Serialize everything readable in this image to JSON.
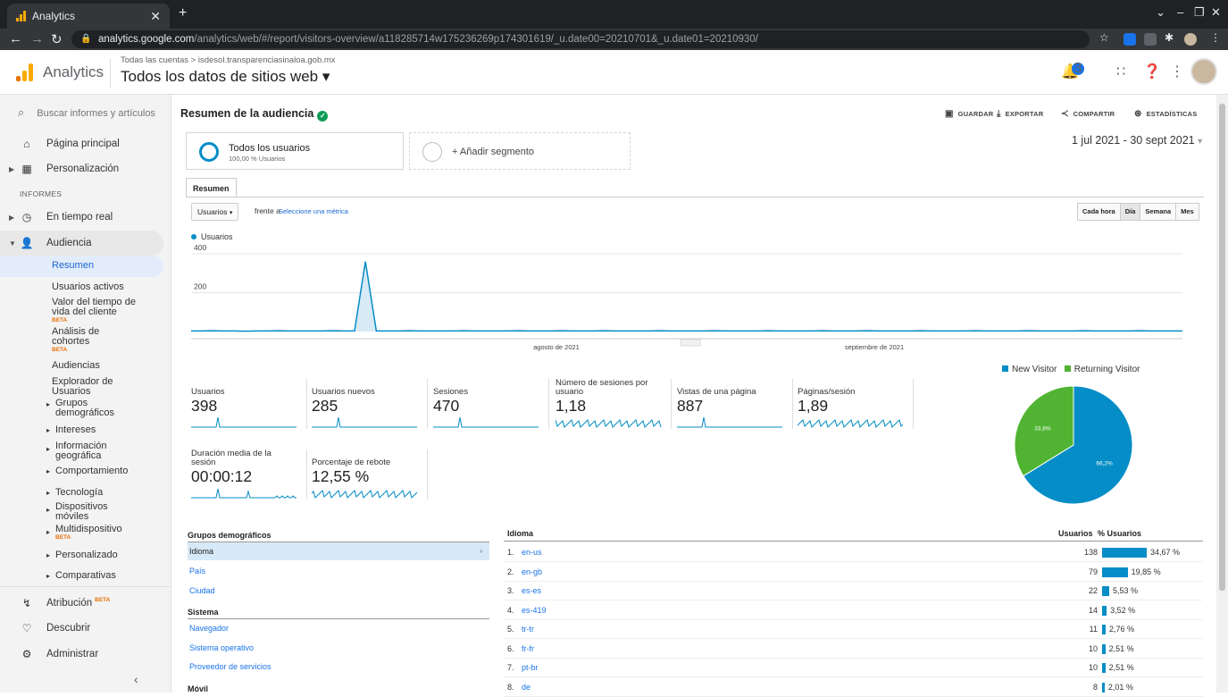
{
  "browser": {
    "tab_title": "Analytics",
    "url_host": "analytics.google.com",
    "url_path": "/analytics/web/#/report/visitors-overview/a118285714w175236269p174301619/_u.date00=20210701&_u.date01=20210930/"
  },
  "header": {
    "app_name": "Analytics",
    "breadcrumb": "Todas las cuentas > isdesol.transparenciasinaloa.gob.mx",
    "property": "Todos los datos de sitios web ▾",
    "notif_count": "3"
  },
  "sidebar": {
    "search_placeholder": "Buscar informes y artículos",
    "home": "Página principal",
    "custom": "Personalización",
    "section_reports": "INFORMES",
    "realtime": "En tiempo real",
    "audience": "Audiencia",
    "audience_items": [
      "Resumen",
      "Usuarios activos",
      "Valor del tiempo de vida del cliente",
      "Análisis de cohortes",
      "Audiencias",
      "Explorador de Usuarios",
      "Grupos demográficos",
      "Intereses",
      "Información geográfica",
      "Comportamiento",
      "Tecnología",
      "Dispositivos móviles",
      "Multidispositivo",
      "Personalizado",
      "Comparativas"
    ],
    "beta": "BETA",
    "attribution": "Atribución",
    "discover": "Descubrir",
    "admin": "Administrar"
  },
  "report": {
    "title": "Resumen de la audiencia",
    "actions": [
      "GUARDAR",
      "EXPORTAR",
      "COMPARTIR",
      "ESTADÍSTICAS"
    ],
    "segment1_title": "Todos los usuarios",
    "segment1_sub": "100,00 % Usuarios",
    "segment2_title": "+ Añadir segmento",
    "date_range": "1 jul 2021 - 30 sept 2021",
    "subtab": "Resumen",
    "metric_select": "Usuarios",
    "vs": "frente a",
    "select_metric": "Seleccione una métrica",
    "granularity": [
      "Cada hora",
      "Día",
      "Semana",
      "Mes"
    ],
    "granularity_active": "Día"
  },
  "chart_data": [
    {
      "type": "area",
      "series": [
        {
          "name": "Usuarios",
          "values": [
            3,
            3,
            4,
            3,
            3,
            2,
            3,
            3,
            4,
            3,
            3,
            3,
            3,
            4,
            3,
            3,
            360,
            3,
            3,
            3,
            4,
            3,
            3,
            3,
            3,
            4,
            3,
            3,
            3,
            3,
            4,
            3,
            3,
            3,
            4,
            3,
            3,
            3,
            4,
            3,
            3,
            3,
            3,
            4,
            3,
            3,
            3,
            3,
            4,
            3,
            3,
            3,
            3,
            4,
            3,
            3,
            3,
            3,
            4,
            3,
            3,
            3,
            4,
            3,
            3,
            3,
            3,
            4,
            3,
            3,
            3,
            3,
            4,
            3,
            3,
            3,
            3,
            4,
            3,
            3,
            3,
            3,
            4,
            3,
            3,
            3,
            3,
            4,
            3,
            3,
            3,
            3
          ]
        }
      ],
      "x_start": "1 jul 2021",
      "y_ticks": [
        "400",
        "200"
      ],
      "ylim": [
        0,
        400
      ],
      "x_labels": [
        "agosto de 2021",
        "septiembre de 2021"
      ]
    },
    {
      "type": "pie",
      "legend": [
        "New Visitor",
        "Returning Visitor"
      ],
      "values": [
        66.2,
        33.8
      ],
      "labels": [
        "66,2%",
        "33,8%"
      ],
      "colors": [
        "#058dc7",
        "#50b432"
      ]
    }
  ],
  "scorecards": [
    {
      "label": "Usuarios",
      "value": "398"
    },
    {
      "label": "Usuarios nuevos",
      "value": "285"
    },
    {
      "label": "Sesiones",
      "value": "470"
    },
    {
      "label": "Número de sesiones por usuario",
      "value": "1,18"
    },
    {
      "label": "Vistas de una página",
      "value": "887"
    },
    {
      "label": "Páginas/sesión",
      "value": "1,89"
    },
    {
      "label": "Duración media de la sesión",
      "value": "00:00:12"
    },
    {
      "label": "Porcentaje de rebote",
      "value": "12,55 %"
    }
  ],
  "dimensions": {
    "groups_title": "Grupos demográficos",
    "groups": [
      "Idioma",
      "País",
      "Ciudad"
    ],
    "system_title": "Sistema",
    "system": [
      "Navegador",
      "Sistema operativo",
      "Proveedor de servicios"
    ],
    "mobile_title": "Móvil"
  },
  "table": {
    "col_dim": "Idioma",
    "col_users": "Usuarios",
    "col_pct": "% Usuarios",
    "rows": [
      {
        "rank": "1.",
        "lang": "en-us",
        "users": "138",
        "pct": "34,67 %",
        "frac": 0.3467
      },
      {
        "rank": "2.",
        "lang": "en-gb",
        "users": "79",
        "pct": "19,85 %",
        "frac": 0.1985
      },
      {
        "rank": "3.",
        "lang": "es-es",
        "users": "22",
        "pct": "5,53 %",
        "frac": 0.0553
      },
      {
        "rank": "4.",
        "lang": "es-419",
        "users": "14",
        "pct": "3,52 %",
        "frac": 0.0352
      },
      {
        "rank": "5.",
        "lang": "tr-tr",
        "users": "11",
        "pct": "2,76 %",
        "frac": 0.0276
      },
      {
        "rank": "6.",
        "lang": "fr-fr",
        "users": "10",
        "pct": "2,51 %",
        "frac": 0.0251
      },
      {
        "rank": "7.",
        "lang": "pt-br",
        "users": "10",
        "pct": "2,51 %",
        "frac": 0.0251
      },
      {
        "rank": "8.",
        "lang": "de",
        "users": "8",
        "pct": "2,01 %",
        "frac": 0.0201
      }
    ]
  }
}
